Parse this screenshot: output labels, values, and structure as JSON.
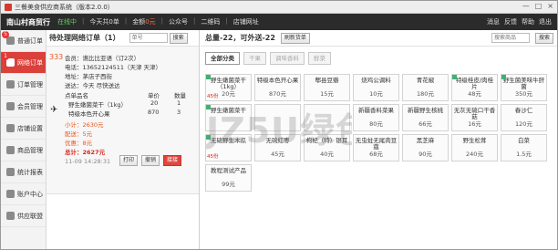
{
  "window": {
    "title": "三餐美食供应商系统（版本2.0.0）",
    "minimize": "—",
    "maximize": "□",
    "close": "×"
  },
  "topbar": {
    "store": "南山村商贸行",
    "online": "在线中",
    "today": "今天共0单",
    "amount_label": "金额",
    "amount": "0元",
    "official_account": "公众号",
    "qrcode": "二维码",
    "website": "店铺网址",
    "right": [
      "消息",
      "反馈",
      "帮助",
      "退出"
    ]
  },
  "sidebar": {
    "items": [
      {
        "label": "普通订单",
        "badge": "5"
      },
      {
        "label": "网络订单",
        "badge": "1"
      },
      {
        "label": "订单管理",
        "badge": ""
      },
      {
        "label": "会员管理",
        "badge": ""
      },
      {
        "label": "店铺设置",
        "badge": ""
      },
      {
        "label": "商品管理",
        "badge": ""
      },
      {
        "label": "统计报表",
        "badge": ""
      },
      {
        "label": "账户中心",
        "badge": ""
      },
      {
        "label": "供应联盟",
        "badge": ""
      }
    ]
  },
  "orders": {
    "title": "待处理网络订单（1）",
    "search_placeholder": "单号",
    "search_btn": "搜索",
    "order": {
      "number": "333",
      "customer": "会员：谯比比亚语（订2次）",
      "phone": "电话：13652124511（天津 天津）",
      "address": "地址：茅店子西街",
      "delivery": "送达：今天 尽快送达",
      "header_name": "点单品名",
      "header_price": "单价",
      "header_qty": "数量",
      "items": [
        {
          "name": "野生嫩菌菜干（1kg）",
          "price": "20",
          "qty": "1"
        },
        {
          "name": "特级本色开心果",
          "price": "870",
          "qty": "3"
        }
      ],
      "subtotal": "小计：2630元",
      "shipping": "配送：5元",
      "discount": "优惠：8元",
      "total": "总计：2627元",
      "time": "11-09 14:28:31",
      "print": "打印",
      "cancel": "撤销",
      "accept": "接接"
    }
  },
  "products": {
    "summary": "总量-22，可外送-22",
    "refresh": "刷新货单",
    "search_placeholder": "搜索商品",
    "search_btn": "搜索",
    "tabs": [
      "全部分类",
      "干果",
      "调味香料",
      "鲜菜"
    ],
    "items": [
      {
        "name": "野生嫩菌菜干（1kg）",
        "price": "20元",
        "stock": "45份",
        "marker": true
      },
      {
        "name": "特级本色开心果",
        "price": "870元",
        "stock": "",
        "marker": false
      },
      {
        "name": "郫县豆瓣",
        "price": "15元",
        "stock": "",
        "marker": false
      },
      {
        "name": "烧鸡公调料",
        "price": "10元",
        "stock": "",
        "marker": false
      },
      {
        "name": "青花椒",
        "price": "180元",
        "stock": "",
        "marker": false
      },
      {
        "name": "特级桂皮/肉桂片",
        "price": "48元",
        "stock": "",
        "marker": true
      },
      {
        "name": "野生菌美味牛肝菌",
        "price": "350元",
        "stock": "",
        "marker": true
      },
      {
        "name": "野生嫩菌菜干",
        "price": "",
        "stock": "",
        "marker": true
      },
      {
        "name": "",
        "price": "",
        "stock": "",
        "marker": false
      },
      {
        "name": "",
        "price": "",
        "stock": "",
        "marker": false
      },
      {
        "name": "新疆香料菜果",
        "price": "80元",
        "stock": "",
        "marker": false
      },
      {
        "name": "新疆野生核桃",
        "price": "66元",
        "stock": "",
        "marker": false
      },
      {
        "name": "无灰无硫口干香菇",
        "price": "16元",
        "stock": "",
        "marker": false
      },
      {
        "name": "春沙仁",
        "price": "120元",
        "stock": "",
        "marker": false
      },
      {
        "name": "无硫野生木瓜",
        "price": "",
        "stock": "45份",
        "marker": true
      },
      {
        "name": "无硫红枣",
        "price": "45元",
        "stock": "",
        "marker": false
      },
      {
        "name": "枸杞（特）银耳",
        "price": "40元",
        "stock": "",
        "marker": false
      },
      {
        "name": "无虫蛀无尾肉豆蔻",
        "price": "68元",
        "stock": "",
        "marker": false
      },
      {
        "name": "黑芝麻",
        "price": "90元",
        "stock": "",
        "marker": false
      },
      {
        "name": "野生松茸",
        "price": "240元",
        "stock": "",
        "marker": false
      },
      {
        "name": "白菜",
        "price": "1.5元",
        "stock": "",
        "marker": false
      },
      {
        "name": "教程测试产品",
        "price": "99元",
        "stock": "",
        "marker": false
      }
    ]
  },
  "watermark": "JZ5U绿色下载",
  "colors": {
    "accent": "#d9413a",
    "orange": "#e8581f",
    "dark_bar": "#2b2b2b",
    "marker": "#3cb371"
  }
}
